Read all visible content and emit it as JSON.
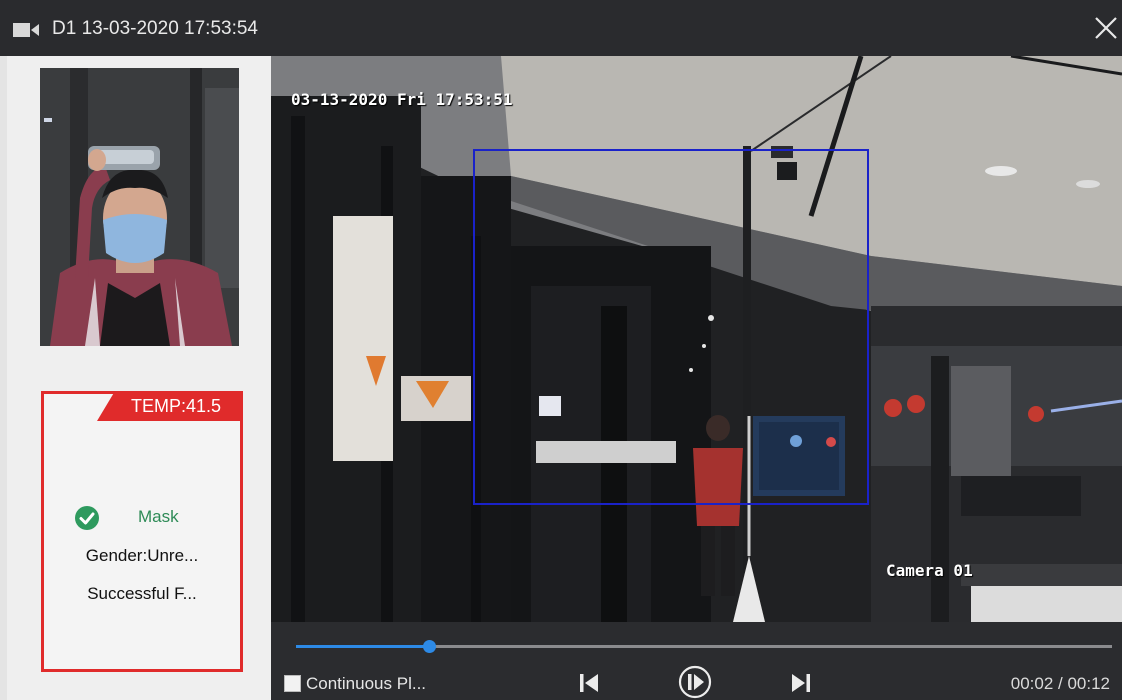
{
  "titlebar": {
    "title": "D1 13-03-2020 17:53:54",
    "icon": "video-camera-icon",
    "close_icon": "close-icon"
  },
  "snapshot": {
    "description_icon": "face-snapshot"
  },
  "info_card": {
    "temperature": "TEMP:41.5",
    "mask_status": "Mask",
    "gender": "Gender:Unre...",
    "result": "Successful F...",
    "accent_color": "#e02b2b",
    "mask_color": "#2e8b57"
  },
  "video": {
    "osd_datetime": "03-13-2020 Fri 17:53:51",
    "osd_camera": "Camera 01",
    "detection_box_color": "#1a22c9"
  },
  "controls": {
    "continuous_label": "Continuous Pl...",
    "continuous_checked": false,
    "time": "00:02 / 00:12",
    "progress_fraction": 0.163,
    "accent_color": "#2d8ae6",
    "prev_icon": "previous-icon",
    "play_icon": "play-pause-icon",
    "next_icon": "next-icon"
  }
}
